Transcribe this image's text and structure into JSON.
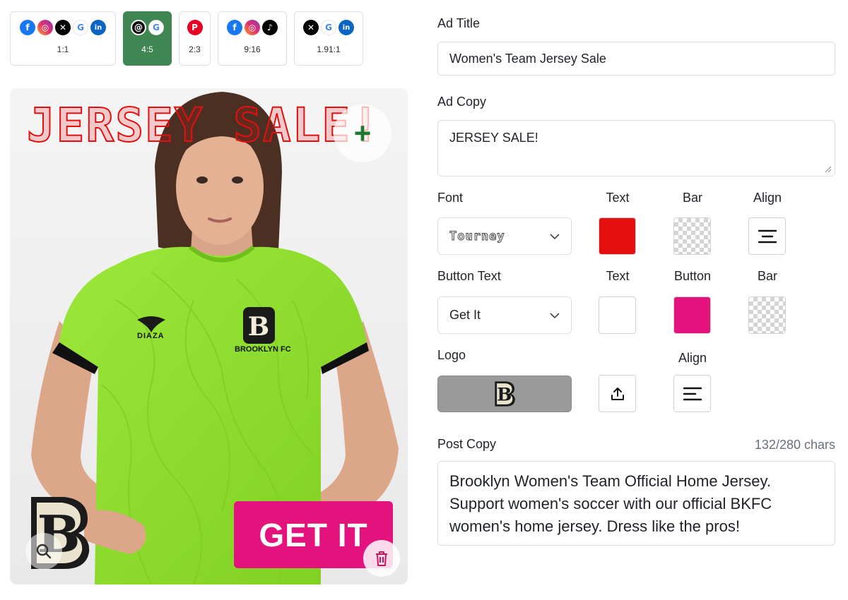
{
  "ratios": [
    {
      "label": "1:1",
      "icons": [
        "facebook-icon",
        "instagram-icon",
        "x-icon",
        "google-icon",
        "linkedin-icon"
      ],
      "active": false
    },
    {
      "label": "4:5",
      "icons": [
        "threads-icon",
        "google-icon"
      ],
      "active": true
    },
    {
      "label": "2:3",
      "icons": [
        "pinterest-icon"
      ],
      "active": false
    },
    {
      "label": "9:16",
      "icons": [
        "facebook-icon",
        "instagram-icon",
        "tiktok-icon"
      ],
      "active": false
    },
    {
      "label": "1.91:1",
      "icons": [
        "x-icon",
        "google-icon",
        "linkedin-icon"
      ],
      "active": false
    }
  ],
  "preview": {
    "headline": "JERSEY SALE!",
    "cta": "GET IT",
    "jersey_brand": "DIAZA",
    "jersey_club": "BROOKLYN FC",
    "logo_letter": "B"
  },
  "form": {
    "ad_title_label": "Ad Title",
    "ad_title_value": "Women's Team Jersey Sale",
    "ad_copy_label": "Ad Copy",
    "ad_copy_value": "JERSEY SALE!",
    "font_label": "Font",
    "font_value": "Tourney",
    "text_label": "Text",
    "bar_label": "Bar",
    "align_label": "Align",
    "button_text_label": "Button Text",
    "button_text_value": "Get It",
    "button_label": "Button",
    "logo_label": "Logo",
    "post_copy_label": "Post Copy",
    "post_copy_count": "132/280 chars",
    "post_copy_value": "Brooklyn Women's Team Official Home Jersey. Support women's soccer with our official BKFC women's home jersey. Dress like the pros!"
  },
  "colors": {
    "active_tab": "#3f8653",
    "headline_text": "#e4100f",
    "cta_button": "#e3127c",
    "button_text_color": "#ffffff",
    "jersey": "#8ee02a",
    "logo_bg": "#9a9a9a"
  }
}
